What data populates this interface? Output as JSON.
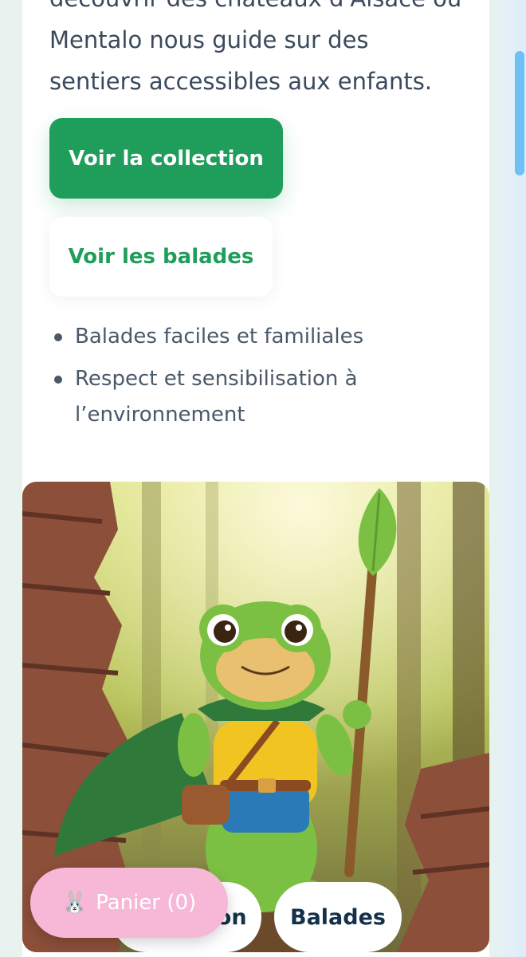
{
  "intro": {
    "line1": "découvrir des châteaux d'Alsace où",
    "line2": "Mentalo nous guide sur des",
    "line3": "sentiers accessibles aux enfants."
  },
  "actions": {
    "primary_label": "Voir la collection",
    "secondary_label": "Voir les balades"
  },
  "features": [
    "Balades faciles et familiales",
    "Respect et sensibilisation à l’environnement"
  ],
  "hero": {
    "overlay_tabs": [
      "Collection",
      "Balades"
    ]
  },
  "cart": {
    "icon": "rabbit-icon",
    "label": "Panier (0)"
  },
  "colors": {
    "accent": "#1f9d5a",
    "text": "#3a4a5c",
    "cart": "#f7b8d8",
    "scrollbar": "#6fc0f4"
  }
}
